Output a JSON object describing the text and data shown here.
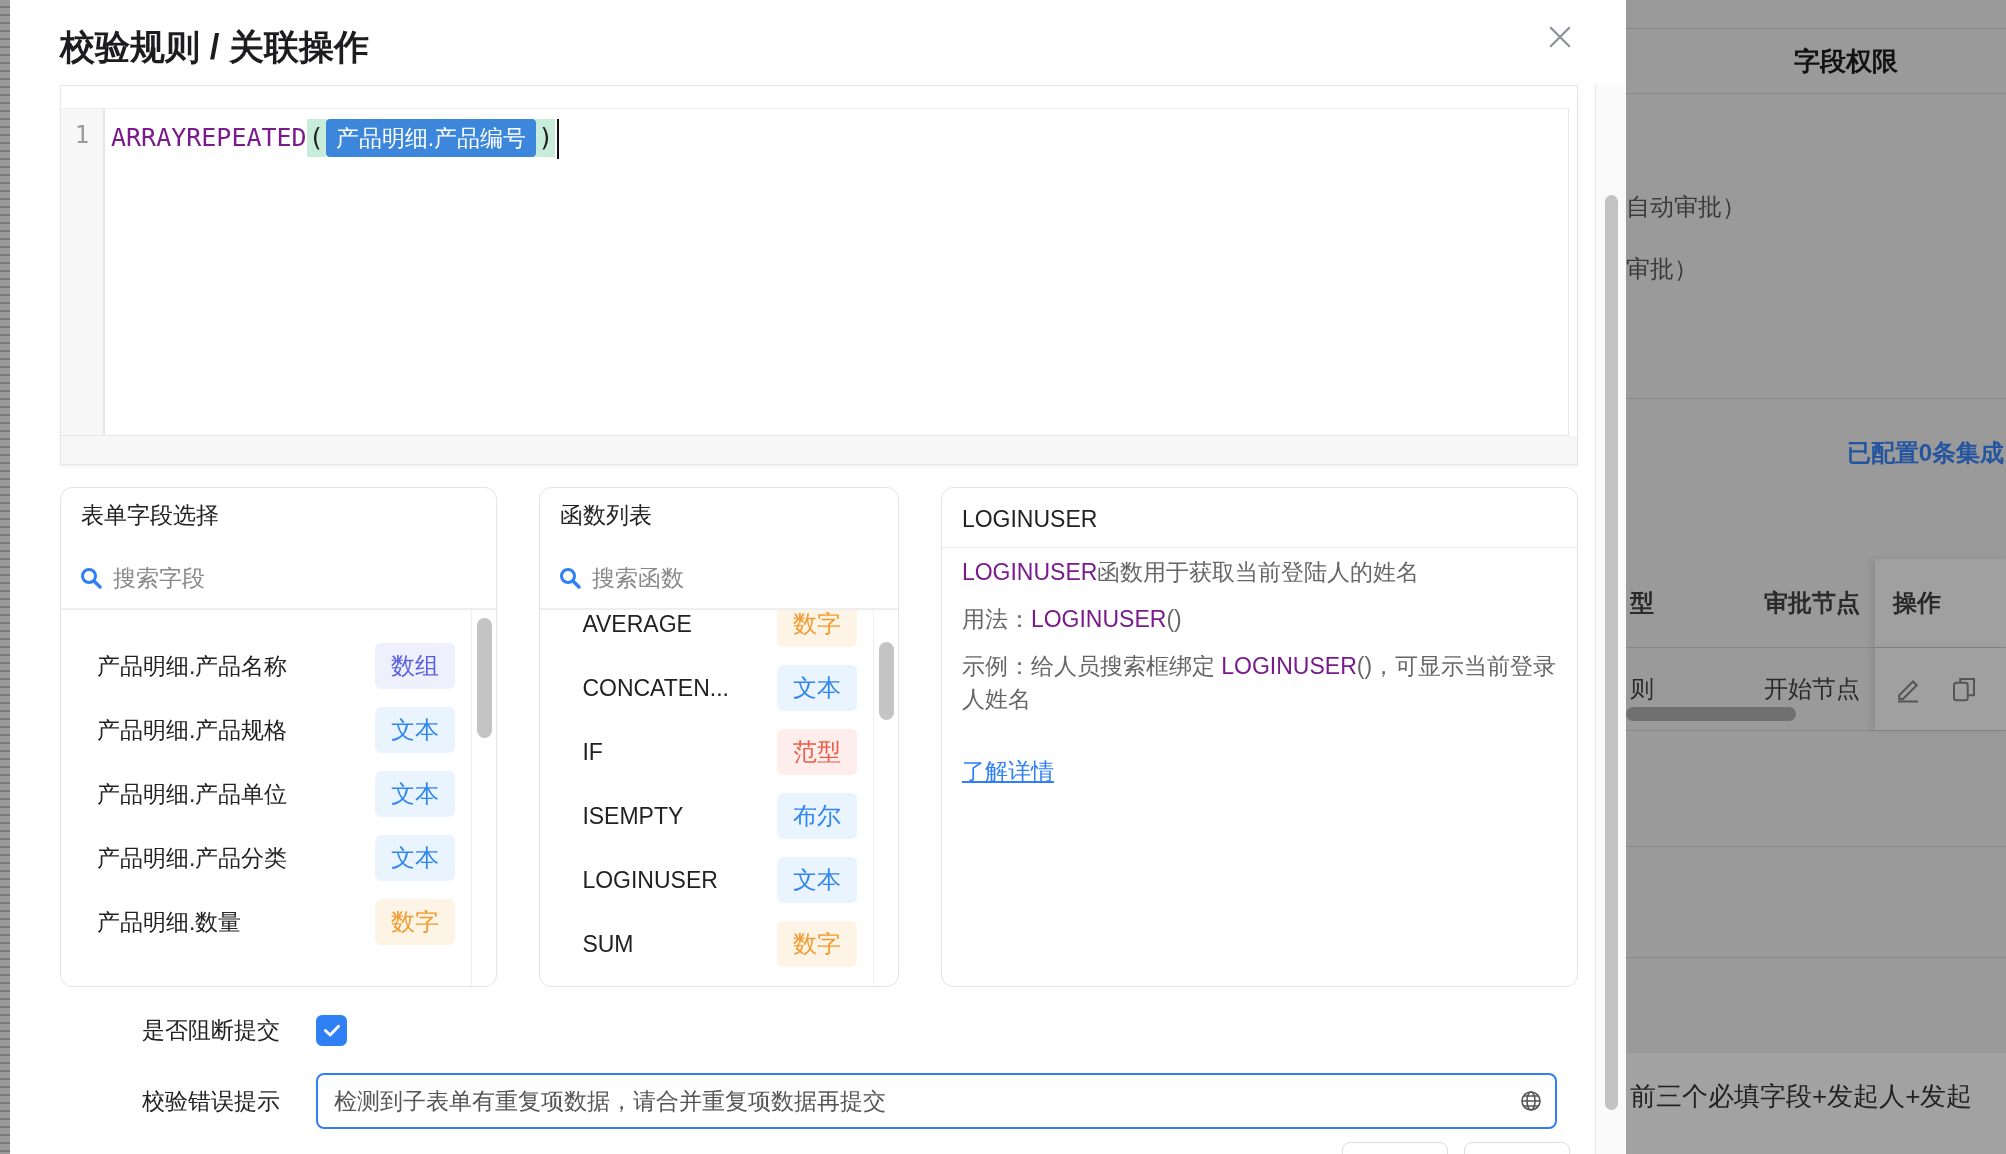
{
  "dialog": {
    "title": "校验规则 / 关联操作"
  },
  "editor": {
    "line_number": "1",
    "function": "ARRAYREPEATED",
    "open_paren": "(",
    "field_token": "产品明细.产品编号",
    "close_paren": ")"
  },
  "field_panel": {
    "title": "表单字段选择",
    "search": {
      "placeholder": "搜索字段"
    },
    "items": [
      {
        "name": "产品明细.产品名称",
        "type_label": "数组",
        "kind": "array"
      },
      {
        "name": "产品明细.产品规格",
        "type_label": "文本",
        "kind": "text"
      },
      {
        "name": "产品明细.产品单位",
        "type_label": "文本",
        "kind": "text"
      },
      {
        "name": "产品明细.产品分类",
        "type_label": "文本",
        "kind": "text"
      },
      {
        "name": "产品明细.数量",
        "type_label": "数字",
        "kind": "number"
      }
    ]
  },
  "function_panel": {
    "title": "函数列表",
    "search": {
      "placeholder": "搜索函数"
    },
    "items": [
      {
        "name": "AVERAGE",
        "type_label": "数字",
        "kind": "number"
      },
      {
        "name": "CONCATEN...",
        "type_label": "文本",
        "kind": "text"
      },
      {
        "name": "IF",
        "type_label": "范型",
        "kind": "generic"
      },
      {
        "name": "ISEMPTY",
        "type_label": "布尔",
        "kind": "boolean"
      },
      {
        "name": "LOGINUSER",
        "type_label": "文本",
        "kind": "text"
      },
      {
        "name": "SUM",
        "type_label": "数字",
        "kind": "number"
      }
    ]
  },
  "detail_panel": {
    "title": "LOGINUSER",
    "paragraphs": [
      [
        {
          "text": "LOGINUSER",
          "kind": "code"
        },
        {
          "text": "函数用于获取当前登陆人的姓名",
          "kind": "plain"
        }
      ],
      [
        {
          "text": "用法：",
          "kind": "plain"
        },
        {
          "text": "LOGINUSER",
          "kind": "code"
        },
        {
          "text": "()",
          "kind": "plain"
        }
      ],
      [
        {
          "text": "示例：给人员搜索框绑定 ",
          "kind": "plain"
        },
        {
          "text": "LOGINUSER",
          "kind": "code"
        },
        {
          "text": "()，可显示当前登录人姓名",
          "kind": "plain"
        }
      ]
    ],
    "link": "了解详情"
  },
  "block_submit": {
    "label": "是否阻断提交",
    "checked": true
  },
  "error_hint": {
    "label": "校验错误提示",
    "value": "检测到子表单有重复项数据，请合并重复项数据再提交"
  },
  "background": {
    "header": "字段权限",
    "lines": [
      "自动审批）",
      "审批）"
    ],
    "integration": "已配置0条集成",
    "table": {
      "columns": [
        "型",
        "审批节点",
        "操作"
      ],
      "row": [
        "则",
        "开始节点"
      ]
    },
    "footer_text": "前三个必填字段+发起人+发起"
  }
}
